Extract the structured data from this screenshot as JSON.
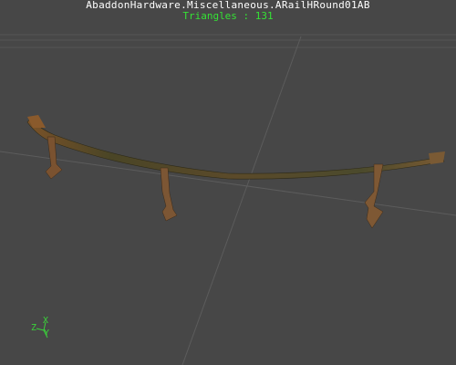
{
  "viewer": {
    "mesh_name": "AbaddonHardware.Miscellaneous.ARailHRound01AB",
    "triangles_label": "Triangles : 131"
  },
  "axis_gizmo": {
    "labels": [
      "Z",
      "X",
      "Y"
    ]
  },
  "colors": {
    "background": "#474747",
    "grid_line": "#5c5c5c",
    "title_text": "#ffffff",
    "triangles_text": "#35e235",
    "axis_z": "#3ad13a",
    "axis_x": "#3ad13a",
    "axis_y": "#3ad13a",
    "rail_dark": "#3e3a22",
    "rail_rust": "#8a5a2a"
  }
}
